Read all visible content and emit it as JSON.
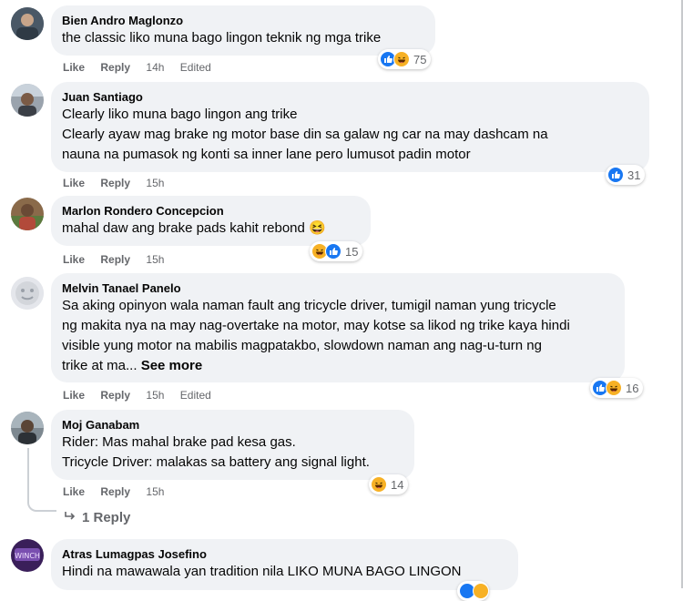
{
  "actions": {
    "like": "Like",
    "reply": "Reply",
    "edited": "Edited",
    "see_more": "See more"
  },
  "comments": [
    {
      "author": "Bien Andro Maglonzo",
      "lines": [
        "the classic liko muna bago lingon teknik ng mga trike"
      ],
      "time": "14h",
      "edited": true,
      "reactions": [
        "like",
        "haha"
      ],
      "reaction_count": "75"
    },
    {
      "author": "Juan Santiago",
      "lines": [
        "Clearly liko muna bago lingon ang trike",
        "Clearly ayaw mag brake ng motor base din sa galaw ng car na may dashcam na",
        "nauna na pumasok ng konti sa inner lane pero lumusot padin motor"
      ],
      "time": "15h",
      "edited": false,
      "reactions": [
        "like"
      ],
      "reaction_count": "31"
    },
    {
      "author": "Marlon Rondero Concepcion",
      "lines": [
        "mahal daw ang brake pads kahit rebond 😆"
      ],
      "time": "15h",
      "edited": false,
      "reactions": [
        "haha",
        "like"
      ],
      "reaction_count": "15"
    },
    {
      "author": "Melvin Tanael Panelo",
      "lines": [
        "Sa aking opinyon wala naman fault ang tricycle driver, tumigil naman yung tricycle",
        "ng makita nya na may nag-overtake na motor, may kotse sa likod ng trike kaya hindi",
        "visible yung motor na mabilis magpatakbo, slowdown naman ang nag-u-turn ng",
        "trike at ma..."
      ],
      "time": "15h",
      "edited": true,
      "reactions": [
        "like",
        "haha"
      ],
      "reaction_count": "16"
    },
    {
      "author": "Moj Ganabam",
      "lines": [
        "Rider: Mas mahal brake pad kesa gas.",
        "Tricycle Driver: malakas sa battery ang signal light."
      ],
      "time": "15h",
      "edited": false,
      "reactions": [
        "haha"
      ],
      "reaction_count": "14",
      "replies_label": "1 Reply"
    },
    {
      "author": "Atras Lumagpas Josefino",
      "lines": [
        "Hindi na mawawala yan tradition nila LIKO MUNA BAGO LINGON"
      ],
      "time": "",
      "edited": false,
      "reactions": [],
      "reaction_count": ""
    }
  ],
  "colors": {
    "like_blue": "#1877f2",
    "haha_yellow": "#f7b125",
    "bubble": "#f0f2f5",
    "meta_gray": "#65676b"
  }
}
